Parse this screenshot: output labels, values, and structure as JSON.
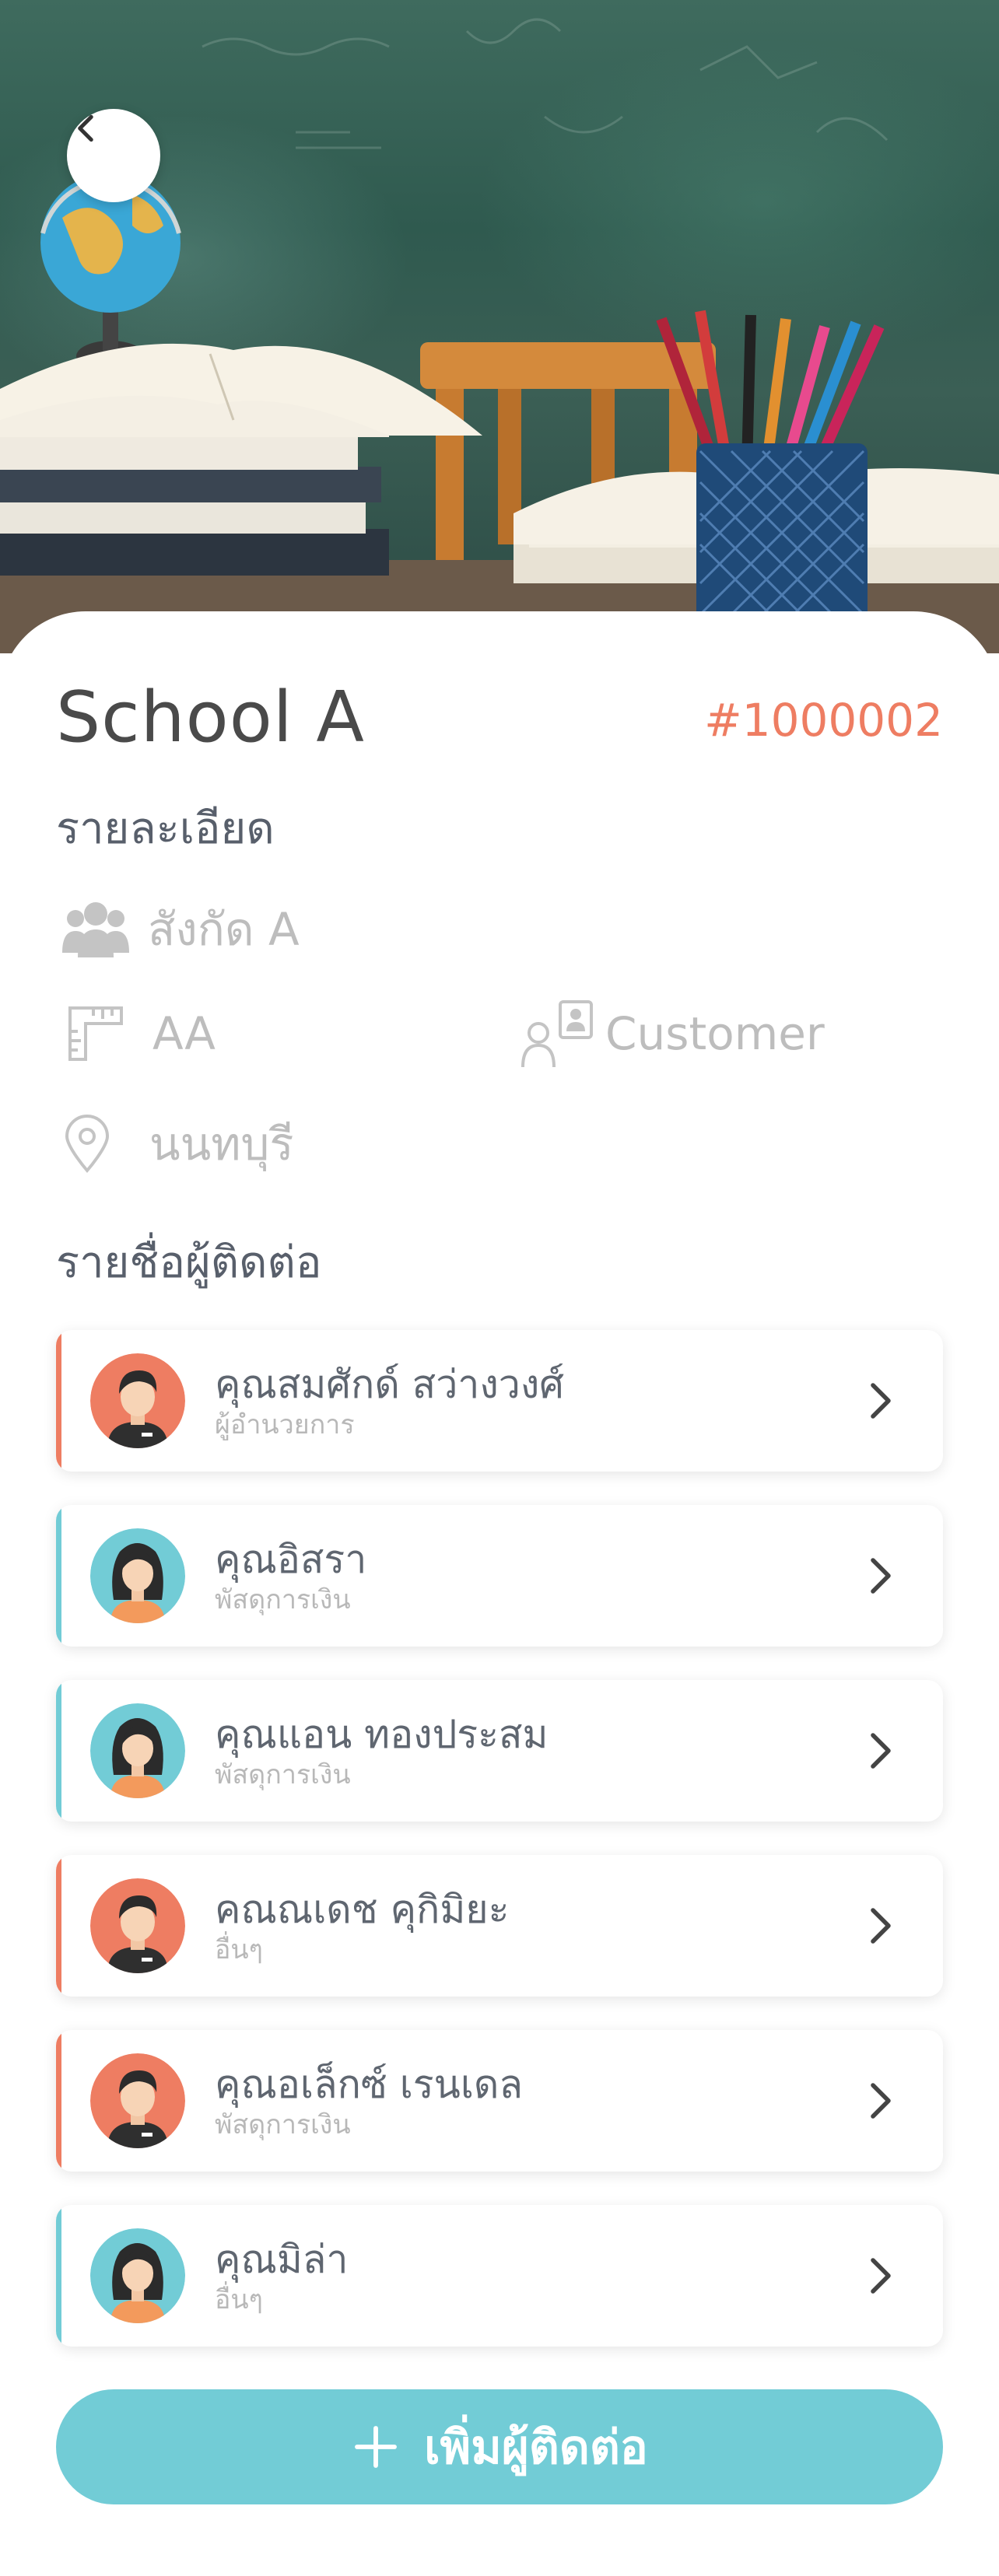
{
  "school": {
    "name": "School A",
    "code": "#1000002"
  },
  "details": {
    "title": "รายละเอียด",
    "affiliation": "สังกัด A",
    "size": "AA",
    "type": "Customer",
    "location": "นนทบุรี"
  },
  "contacts": {
    "title": "รายชื่อผู้ติดต่อ",
    "items": [
      {
        "name": "คุณสมศักด์ สว่างวงศ์",
        "role": "ผู้อำนวยการ",
        "gender": "male",
        "accent": "#ee7d62"
      },
      {
        "name": "คุณอิสรา",
        "role": "พัสดุการเงิน",
        "gender": "female",
        "accent": "#72ccd6"
      },
      {
        "name": "คุณแอน ทองประสม",
        "role": "พัสดุการเงิน",
        "gender": "female",
        "accent": "#72ccd6"
      },
      {
        "name": "คณณเดช คุกิมิยะ",
        "role": "อื่นๆ",
        "gender": "male",
        "accent": "#ee7d62"
      },
      {
        "name": "คุณอเล็กซ์ เรนเดล",
        "role": "พัสดุการเงิน",
        "gender": "male",
        "accent": "#ee7d62"
      },
      {
        "name": "คุณมิล่า",
        "role": "อื่นๆ",
        "gender": "female",
        "accent": "#72ccd6"
      }
    ]
  },
  "add_button": {
    "label": "เพิ่มผู้ติดต่อ",
    "icon": "plus-icon",
    "color": "#72ccd6"
  },
  "icons": {
    "back": "chevron-left-icon",
    "affiliation": "users-icon",
    "size": "ruler-icon",
    "type": "contact-card-icon",
    "location": "map-pin-icon",
    "row": "chevron-right-icon"
  }
}
